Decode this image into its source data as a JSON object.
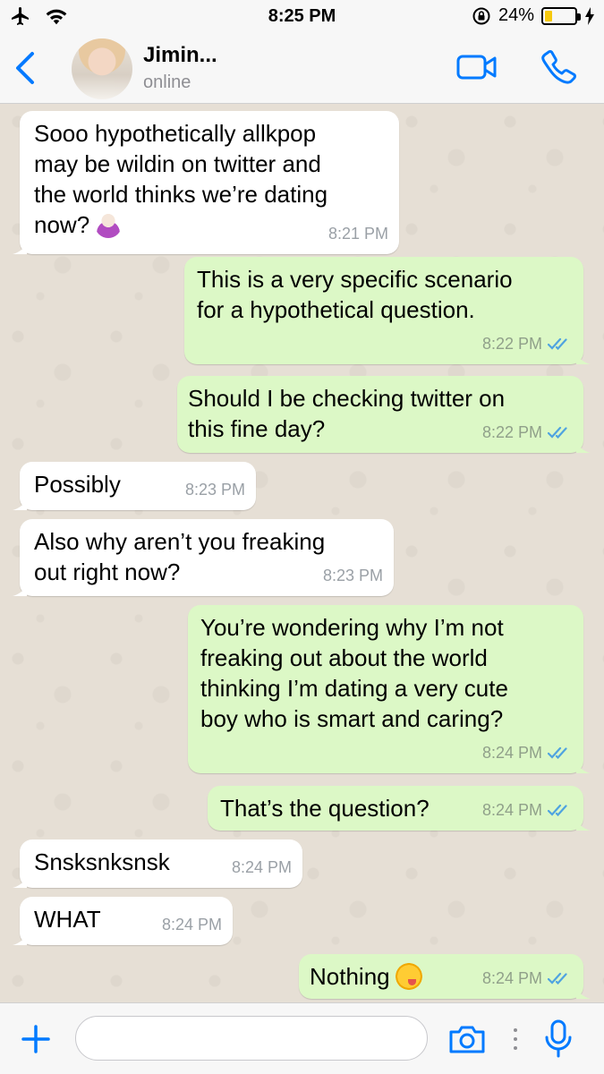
{
  "status_bar": {
    "time": "8:25 PM",
    "battery_percent_label": "24%",
    "battery_level": 0.24,
    "icons": [
      "airplane-icon",
      "wifi-icon",
      "orientation-lock-icon",
      "battery-icon",
      "charging-icon"
    ]
  },
  "header": {
    "contact_name": "Jimin...",
    "contact_status": "online",
    "back_icon": "chevron-left-icon",
    "video_icon": "video-camera-icon",
    "call_icon": "phone-icon"
  },
  "messages": [
    {
      "direction": "in",
      "text": "Sooo hypothetically allkpop\nmay be wildin on twitter and\nthe world thinks we’re dating\nnow?",
      "emoji": "woman-shrugging-emoji",
      "time": "8:21 PM"
    },
    {
      "direction": "out",
      "text": "This is a very specific scenario\nfor a hypothetical question.",
      "time": "8:22 PM",
      "status": "read"
    },
    {
      "direction": "out",
      "text": "Should I be checking twitter on\nthis fine day?",
      "time": "8:22 PM",
      "status": "read"
    },
    {
      "direction": "in",
      "text": "Possibly",
      "time": "8:23 PM"
    },
    {
      "direction": "in",
      "text": "Also why aren’t you freaking\nout right now?",
      "time": "8:23 PM"
    },
    {
      "direction": "out",
      "text": "You’re wondering why I’m not\nfreaking out about the world\nthinking I’m dating a very cute\nboy who is smart and caring?",
      "time": "8:24 PM",
      "status": "read"
    },
    {
      "direction": "out",
      "text": "That’s the question?",
      "time": "8:24 PM",
      "status": "read"
    },
    {
      "direction": "in",
      "text": "Snsksnksnsk",
      "time": "8:24 PM"
    },
    {
      "direction": "in",
      "text": "WHAT",
      "time": "8:24 PM"
    },
    {
      "direction": "out",
      "text": "Nothing",
      "emoji": "face-savoring-food-emoji",
      "time": "8:24 PM",
      "status": "read"
    }
  ],
  "input_bar": {
    "placeholder": "",
    "value": "",
    "icons": [
      "plus-icon",
      "camera-icon",
      "more-icon",
      "microphone-icon"
    ]
  },
  "colors": {
    "accent": "#007aff",
    "outgoing_bubble": "#dcf8c6",
    "incoming_bubble": "#ffffff",
    "read_tick": "#4fa3e0",
    "battery_fill": "#f6c90e"
  }
}
